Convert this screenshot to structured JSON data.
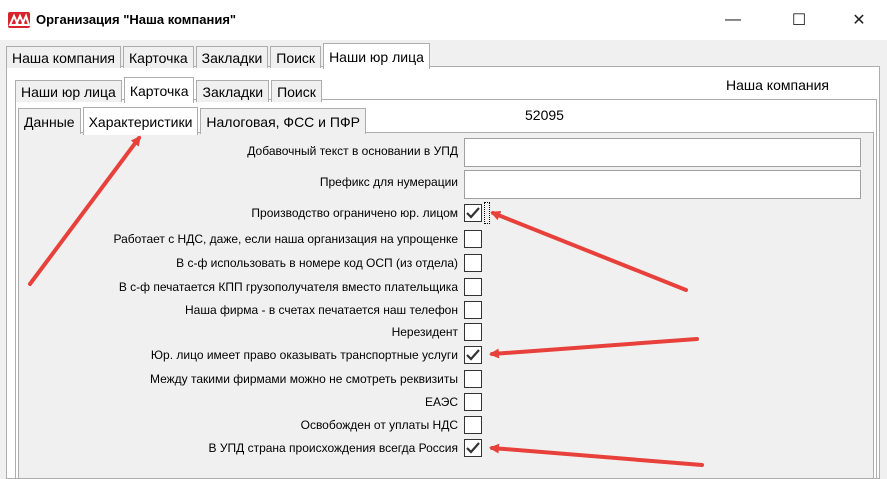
{
  "window": {
    "title": "Организация \"Наша компания\"",
    "app_icon": "company-logo-icon",
    "controls": [
      "minimize-icon",
      "maximize-icon",
      "close-icon"
    ],
    "minimize_glyph": "—",
    "maximize_glyph": "☐",
    "close_glyph": "✕"
  },
  "tabs_level1": {
    "items": [
      "Наша компания",
      "Карточка",
      "Закладки",
      "Поиск",
      "Наши юр лица"
    ],
    "active": "Наши юр лица"
  },
  "tabs_level2": {
    "items": [
      "Наши юр лица",
      "Карточка",
      "Закладки",
      "Поиск"
    ],
    "active": "Карточка"
  },
  "tabs_level3": {
    "items": [
      "Данные",
      "Характеристики",
      "Налоговая, ФСС и ПФР"
    ],
    "active": "Характеристики"
  },
  "header": {
    "company_name": "Наша компания",
    "id_value": "52095"
  },
  "fields": [
    {
      "label": "Добавочный текст в основании в УПД",
      "type": "text",
      "value": ""
    },
    {
      "label": "Префикс для нумерации",
      "type": "text",
      "value": ""
    },
    {
      "label": "Производство ограничено юр. лицом",
      "type": "checkbox",
      "checked": true
    },
    {
      "label": "Работает с НДС, даже, если наша организация на упрощенке",
      "type": "checkbox",
      "checked": false
    },
    {
      "label": "В с-ф использовать в номере код ОСП (из отдела)",
      "type": "checkbox",
      "checked": false
    },
    {
      "label": "В с-ф печатается КПП грузополучателя вместо плательщика",
      "type": "checkbox",
      "checked": false
    },
    {
      "label": "Наша фирма - в счетах печатается наш телефон",
      "type": "checkbox",
      "checked": false
    },
    {
      "label": "Нерезидент",
      "type": "checkbox",
      "checked": false
    },
    {
      "label": "Юр. лицо имеет право оказывать транспортные услуги",
      "type": "checkbox",
      "checked": true
    },
    {
      "label": "Между такими фирмами можно не смотреть реквизиты",
      "type": "checkbox",
      "checked": false
    },
    {
      "label": "ЕАЭС",
      "type": "checkbox",
      "checked": false
    },
    {
      "label": "Освобожден от уплаты НДС",
      "type": "checkbox",
      "checked": false
    },
    {
      "label": "В УПД страна происхождения всегда Россия",
      "type": "checkbox",
      "checked": true
    }
  ],
  "colors": {
    "annotation_arrow": "#e8403a",
    "app_icon_bg": "#d8232a"
  }
}
